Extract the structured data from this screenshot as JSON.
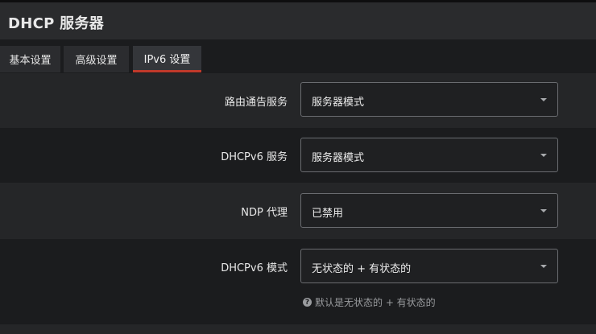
{
  "header": {
    "title": "DHCP 服务器"
  },
  "tabs": [
    {
      "label": "基本设置"
    },
    {
      "label": "高级设置"
    },
    {
      "label": "IPv6 设置"
    }
  ],
  "active_tab": "IPv6 设置",
  "fields": [
    {
      "label": "路由通告服务",
      "value": "服务器模式"
    },
    {
      "label": "DHCPv6 服务",
      "value": "服务器模式"
    },
    {
      "label": "NDP 代理",
      "value": "已禁用"
    },
    {
      "label": "DHCPv6 模式",
      "value": "无状态的 + 有状态的",
      "hint": "默认是无状态的 + 有状态的"
    }
  ],
  "icons": {
    "hint": "question-circle-icon",
    "dropdown": "caret-down-icon"
  },
  "colors": {
    "accent": "#c0392b",
    "background": "#1b1c1e",
    "header": "#2a2b2d"
  }
}
